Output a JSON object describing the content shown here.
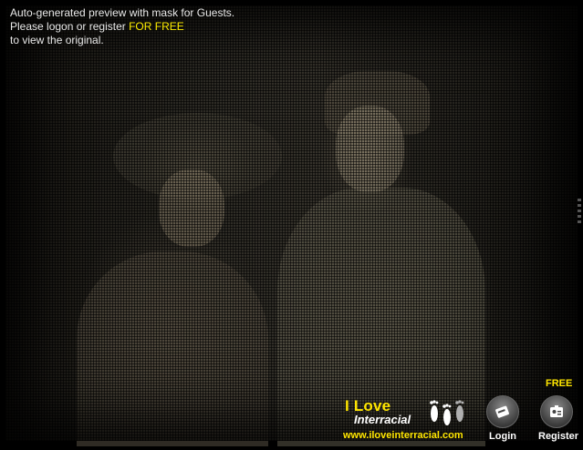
{
  "notice": {
    "line1": "Auto-generated preview with mask for Guests.",
    "line2_prefix": "Please logon or register ",
    "line2_highlight": "FOR FREE",
    "line3": "to view the original."
  },
  "brand": {
    "line1": "I Love",
    "line2": "Interracial",
    "url": "www.iloveinterracial.com"
  },
  "controls": {
    "login_label": "Login",
    "register_label": "Register",
    "register_badge": "FREE"
  },
  "icons": {
    "login": "login-card-icon",
    "register": "register-id-icon",
    "feet": "footprints-icon"
  },
  "colors": {
    "highlight": "#ffee00",
    "text": "#e8e8e8",
    "background": "#000000"
  }
}
